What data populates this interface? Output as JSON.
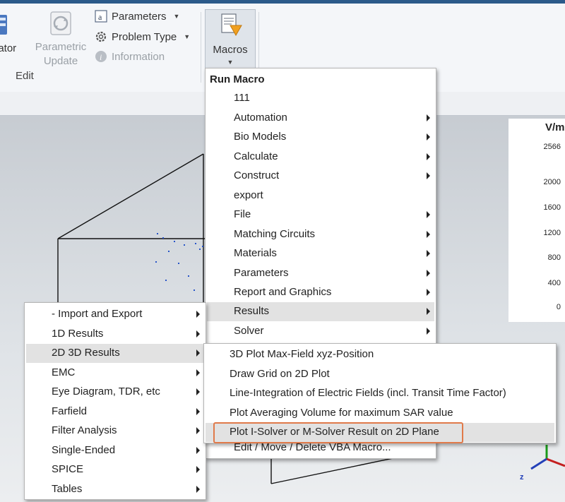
{
  "ribbon": {
    "simulator_label_fragment": "lator",
    "parametric_update": {
      "line1": "Parametric",
      "line2": "Update"
    },
    "parameters": "Parameters",
    "problem_type": "Problem Type",
    "information": "Information",
    "edit_group": "Edit",
    "macros": "Macros"
  },
  "macro_menu": {
    "header": "Run Macro",
    "items": [
      {
        "label": "111",
        "submenu": false
      },
      {
        "label": "Automation",
        "submenu": true
      },
      {
        "label": "Bio Models",
        "submenu": true
      },
      {
        "label": "Calculate",
        "submenu": true
      },
      {
        "label": "Construct",
        "submenu": true
      },
      {
        "label": "export",
        "submenu": false
      },
      {
        "label": "File",
        "submenu": true
      },
      {
        "label": "Matching Circuits",
        "submenu": true
      },
      {
        "label": "Materials",
        "submenu": true
      },
      {
        "label": "Parameters",
        "submenu": true
      },
      {
        "label": "Report and Graphics",
        "submenu": true
      },
      {
        "label": "Results",
        "submenu": true,
        "highlighted": true
      },
      {
        "label": "Solver",
        "submenu": true
      }
    ],
    "footer": "Edit / Move / Delete VBA Macro..."
  },
  "results_menu": {
    "items": [
      {
        "label": "- Import and Export",
        "submenu": true
      },
      {
        "label": "1D Results",
        "submenu": true
      },
      {
        "label": "2D 3D Results",
        "submenu": true,
        "highlighted": true
      },
      {
        "label": "EMC",
        "submenu": true
      },
      {
        "label": "Eye Diagram, TDR, etc",
        "submenu": true
      },
      {
        "label": "Farfield",
        "submenu": true
      },
      {
        "label": "Filter Analysis",
        "submenu": true
      },
      {
        "label": "Single-Ended",
        "submenu": true
      },
      {
        "label": "SPICE",
        "submenu": true
      },
      {
        "label": "Tables",
        "submenu": true
      }
    ]
  },
  "results_2d3d_menu": {
    "items": [
      {
        "label": "3D Plot Max-Field xyz-Position"
      },
      {
        "label": "Draw Grid on 2D Plot"
      },
      {
        "label": "Line-Integration of Electric Fields (incl. Transit Time Factor)"
      },
      {
        "label": "Plot Averaging Volume for maximum SAR value"
      },
      {
        "label": "Plot I-Solver or M-Solver Result on 2D Plane",
        "highlighted": true
      }
    ]
  },
  "legend": {
    "unit": "V/m",
    "ticks": [
      "2566",
      "2000",
      "1600",
      "1200",
      "800",
      "400",
      "0"
    ]
  },
  "axes": {
    "z_label": "z"
  },
  "colors": {
    "highlight_outline": "#e07a4a",
    "title_bar": "#2b5a8a"
  }
}
